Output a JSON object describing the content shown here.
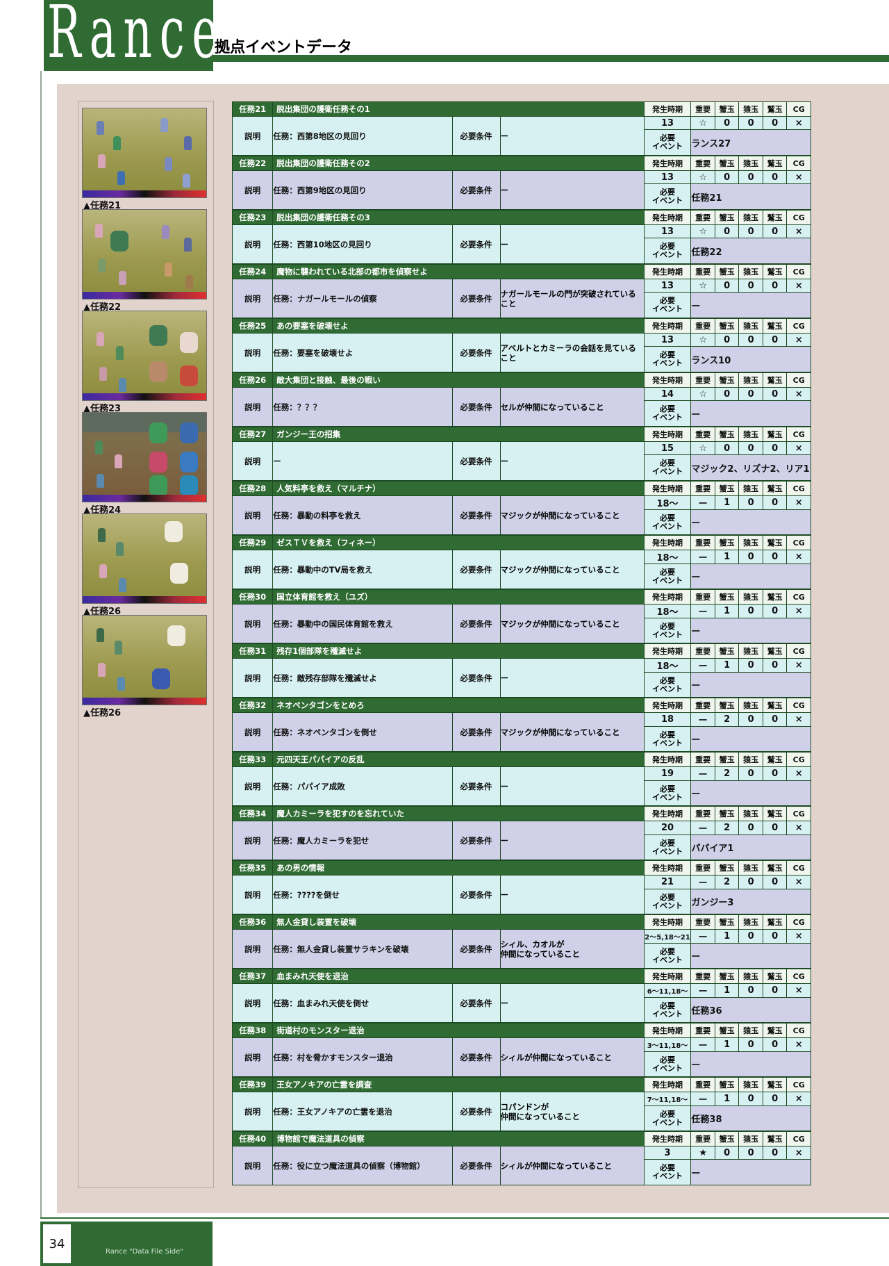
{
  "header": {
    "title": "Rance",
    "subtitle": "拠点イベントデータ"
  },
  "labels": {
    "desc": "説明",
    "req": "必要条件",
    "time": "発生時期",
    "imp": "重要",
    "c1": "蟹玉",
    "c2": "猿玉",
    "c3": "鷲玉",
    "cg": "CG",
    "event": "必要\nイベント"
  },
  "colors": {
    "dark_green": "#2f6b33",
    "cyan": "#d7f1f2",
    "lavender": "#d0d0e8",
    "panel": "#e2d3cd"
  },
  "thumbnails": [
    "▲任務21",
    "▲任務22",
    "▲任務23",
    "▲任務24",
    "▲任務26",
    "▲任務26"
  ],
  "missions": [
    {
      "num": "任務21",
      "title": "脱出集団の護衛任務その1",
      "desc": "任務：西第8地区の見回り",
      "req": "ー",
      "time": "13",
      "imp": "☆",
      "c1": "0",
      "c2": "0",
      "c3": "0",
      "cg": "×",
      "event": "ランス27"
    },
    {
      "num": "任務22",
      "title": "脱出集団の護衛任務その2",
      "desc": "任務：西第9地区の見回り",
      "req": "ー",
      "time": "13",
      "imp": "☆",
      "c1": "0",
      "c2": "0",
      "c3": "0",
      "cg": "×",
      "event": "任務21"
    },
    {
      "num": "任務23",
      "title": "脱出集団の護衛任務その3",
      "desc": "任務：西第10地区の見回り",
      "req": "ー",
      "time": "13",
      "imp": "☆",
      "c1": "0",
      "c2": "0",
      "c3": "0",
      "cg": "×",
      "event": "任務22"
    },
    {
      "num": "任務24",
      "title": "魔物に襲われている北部の都市を偵察せよ",
      "desc": "任務：ナガールモールの偵察",
      "req": "ナガールモールの門が突破されていること",
      "time": "13",
      "imp": "☆",
      "c1": "0",
      "c2": "0",
      "c3": "0",
      "cg": "×",
      "event": "ー"
    },
    {
      "num": "任務25",
      "title": "あの要塞を破壊せよ",
      "desc": "任務：要塞を破壊せよ",
      "req": "アベルトとカミーラの会話を見ていること",
      "time": "13",
      "imp": "☆",
      "c1": "0",
      "c2": "0",
      "c3": "0",
      "cg": "×",
      "event": "ランス10"
    },
    {
      "num": "任務26",
      "title": "敵大集団と接触、最後の戦い",
      "desc": "任務：？？？",
      "req": "セルが仲間になっていること",
      "time": "14",
      "imp": "☆",
      "c1": "0",
      "c2": "0",
      "c3": "0",
      "cg": "×",
      "event": "ー"
    },
    {
      "num": "任務27",
      "title": "ガンジー王の招集",
      "desc": "ー",
      "req": "ー",
      "time": "15",
      "imp": "☆",
      "c1": "0",
      "c2": "0",
      "c3": "0",
      "cg": "×",
      "event": "マジック2、リズナ2、リア1"
    },
    {
      "num": "任務28",
      "title": "人気料亭を救え（マルチナ）",
      "desc": "任務：暴動の料亭を救え",
      "req": "マジックが仲間になっていること",
      "time": "18～",
      "imp": "ー",
      "c1": "1",
      "c2": "0",
      "c3": "0",
      "cg": "×",
      "event": "ー"
    },
    {
      "num": "任務29",
      "title": "ゼスＴＶを救え（フィネー）",
      "desc": "任務：暴動中のTV局を救え",
      "req": "マジックが仲間になっていること",
      "time": "18～",
      "imp": "ー",
      "c1": "1",
      "c2": "0",
      "c3": "0",
      "cg": "×",
      "event": "ー"
    },
    {
      "num": "任務30",
      "title": "国立体育館を救え（ユズ）",
      "desc": "任務：暴動中の国民体育館を救え",
      "req": "マジックが仲間になっていること",
      "time": "18～",
      "imp": "ー",
      "c1": "1",
      "c2": "0",
      "c3": "0",
      "cg": "×",
      "event": "ー"
    },
    {
      "num": "任務31",
      "title": "残存1個部隊を殲滅せよ",
      "desc": "任務：敵残存部隊を殲滅せよ",
      "req": "ー",
      "time": "18～",
      "imp": "ー",
      "c1": "1",
      "c2": "0",
      "c3": "0",
      "cg": "×",
      "event": "ー"
    },
    {
      "num": "任務32",
      "title": "ネオペンタゴンをとめろ",
      "desc": "任務：ネオペンタゴンを倒せ",
      "req": "マジックが仲間になっていること",
      "time": "18",
      "imp": "ー",
      "c1": "2",
      "c2": "0",
      "c3": "0",
      "cg": "×",
      "event": "ー"
    },
    {
      "num": "任務33",
      "title": "元四天王パパイアの反乱",
      "desc": "任務：パパイア成敗",
      "req": "ー",
      "time": "19",
      "imp": "ー",
      "c1": "2",
      "c2": "0",
      "c3": "0",
      "cg": "×",
      "event": "ー"
    },
    {
      "num": "任務34",
      "title": "魔人カミーラを犯すのを忘れていた",
      "desc": "任務：魔人カミーラを犯せ",
      "req": "ー",
      "time": "20",
      "imp": "ー",
      "c1": "2",
      "c2": "0",
      "c3": "0",
      "cg": "×",
      "event": "パパイア1"
    },
    {
      "num": "任務35",
      "title": "あの男の情報",
      "desc": "任務：????を倒せ",
      "req": "ー",
      "time": "21",
      "imp": "ー",
      "c1": "2",
      "c2": "0",
      "c3": "0",
      "cg": "×",
      "event": "ガンジー3"
    },
    {
      "num": "任務36",
      "title": "無人金貸し装置を破壊",
      "desc": "任務：無人金貸し装置サラキンを破壊",
      "req": "シィル、カオルが\n仲間になっていること",
      "time": "2～5,18～21",
      "imp": "ー",
      "c1": "1",
      "c2": "0",
      "c3": "0",
      "cg": "×",
      "event": "ー"
    },
    {
      "num": "任務37",
      "title": "血まみれ天使を退治",
      "desc": "任務：血まみれ天使を倒せ",
      "req": "ー",
      "time": "6～11,18～",
      "imp": "ー",
      "c1": "1",
      "c2": "0",
      "c3": "0",
      "cg": "×",
      "event": "任務36"
    },
    {
      "num": "任務38",
      "title": "街道村のモンスター退治",
      "desc": "任務：村を脅かすモンスター退治",
      "req": "シィルが仲間になっていること",
      "time": "3～11,18～",
      "imp": "ー",
      "c1": "1",
      "c2": "0",
      "c3": "0",
      "cg": "×",
      "event": "ー"
    },
    {
      "num": "任務39",
      "title": "王女アノキアの亡霊を調査",
      "desc": "任務：王女アノキアの亡霊を退治",
      "req": "コパンドンが\n仲間になっていること",
      "time": "7～11,18～",
      "imp": "ー",
      "c1": "1",
      "c2": "0",
      "c3": "0",
      "cg": "×",
      "event": "任務38"
    },
    {
      "num": "任務40",
      "title": "博物館で魔法道具の偵察",
      "desc": "任務：役に立つ魔法道具の偵察（博物館）",
      "req": "シィルが仲間になっていること",
      "time": "3",
      "imp": "★",
      "c1": "0",
      "c2": "0",
      "c3": "0",
      "cg": "×",
      "event": "ー"
    }
  ],
  "footer": {
    "page": "34",
    "text": "Rance \"Data File Side\""
  }
}
